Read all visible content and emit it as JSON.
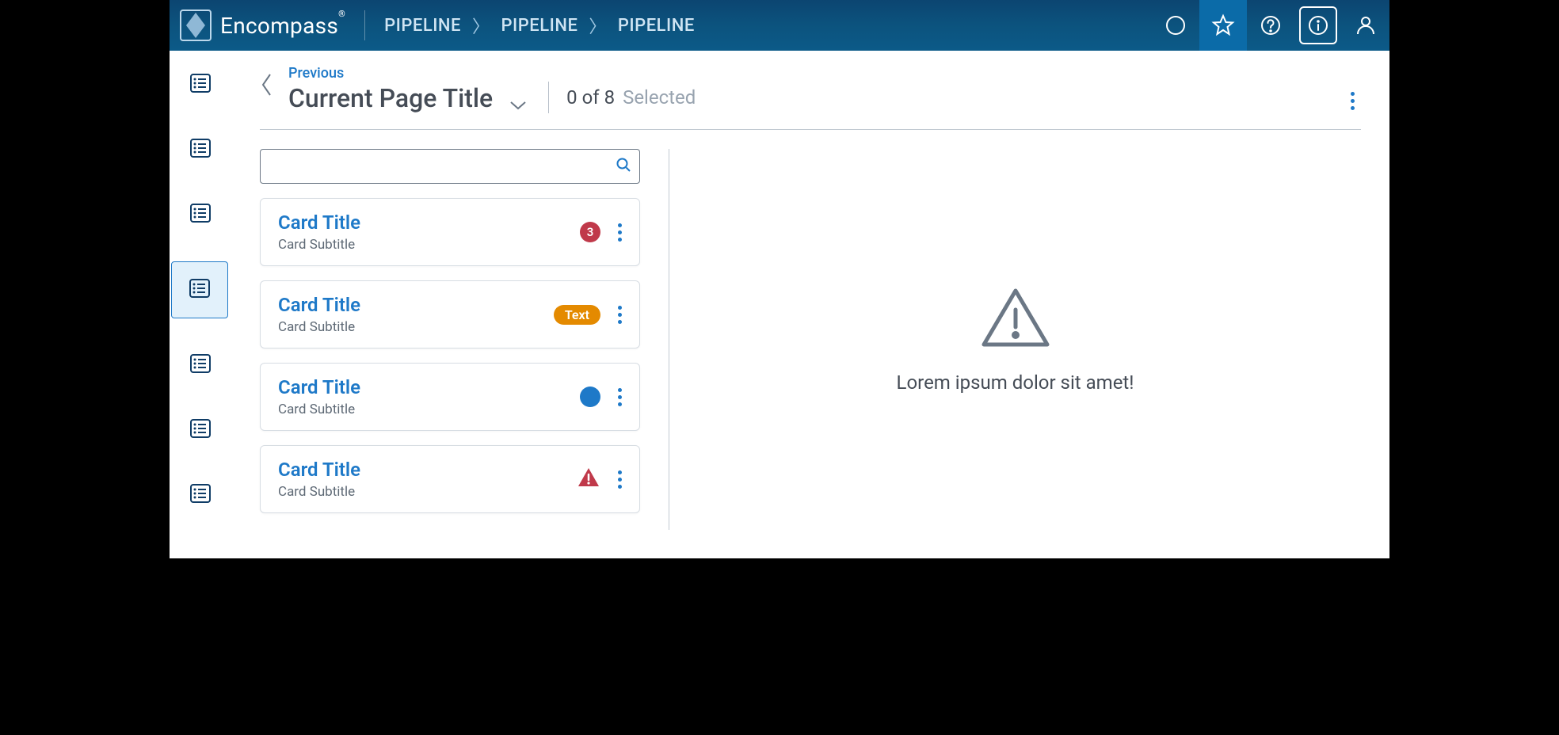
{
  "brand": {
    "name": "Encompass",
    "reg": "®"
  },
  "breadcrumbs": [
    "PIPELINE",
    "PIPELINE",
    "PIPELINE"
  ],
  "page": {
    "previous_label": "Previous",
    "title": "Current Page Title",
    "count": "0 of 8",
    "selected_label": "Selected"
  },
  "search": {
    "placeholder": ""
  },
  "cards": [
    {
      "title": "Card Title",
      "subtitle": "Card Subtitle",
      "badge_type": "number",
      "badge_value": "3"
    },
    {
      "title": "Card Title",
      "subtitle": "Card Subtitle",
      "badge_type": "text",
      "badge_value": "Text"
    },
    {
      "title": "Card Title",
      "subtitle": "Card Subtitle",
      "badge_type": "dot",
      "badge_value": ""
    },
    {
      "title": "Card Title",
      "subtitle": "Card Subtitle",
      "badge_type": "warn",
      "badge_value": ""
    }
  ],
  "empty_state": {
    "message": "Lorem ipsum dolor sit amet!"
  },
  "sidebar": {
    "active_index": 3,
    "count": 7
  }
}
